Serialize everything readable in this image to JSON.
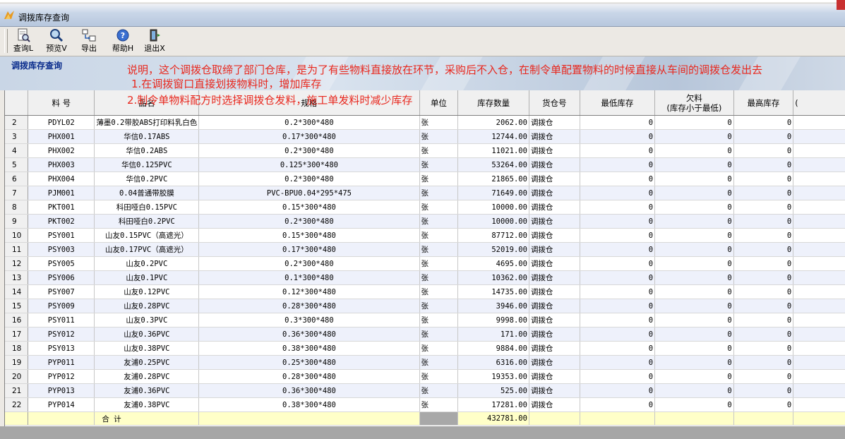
{
  "window": {
    "title": "调拨库存查询"
  },
  "toolbar": [
    {
      "name": "query-button",
      "icon": "document-search-icon",
      "label": "查询L"
    },
    {
      "name": "preview-button",
      "icon": "magnifier-icon",
      "label": "预览V"
    },
    {
      "name": "export-button",
      "icon": "export-icon",
      "label": "导出"
    },
    {
      "name": "help-button",
      "icon": "help-icon",
      "label": "帮助H"
    },
    {
      "name": "exit-button",
      "icon": "exit-door-icon",
      "label": "退出X"
    }
  ],
  "banner": {
    "title": "调拨库存查询",
    "note1": "说明，这个调拨仓取缔了部门仓库，是为了有些物料直接放在环节，采购后不入仓，在制令单配置物料的时候直接从车间的调拨仓发出去",
    "note2": "1.在调拨窗口直接划拨物料时，增加库存",
    "note3": "2.制令单物料配方时选择调拨仓发料，施工单发料时减少库存"
  },
  "columns": {
    "code": "料        号",
    "name": "品名",
    "spec": "规格",
    "unit": "单位",
    "qty": "库存数量",
    "warehouse": "货仓号",
    "min": "最低库存",
    "owe": "欠料",
    "owe_sub": "(库存小于最低)",
    "max": "最高库存",
    "extra": "("
  },
  "rows": [
    {
      "n": "2",
      "code": "PDYL02",
      "name": "薄墨0.2带胶ABS打印料乳白色",
      "spec": "0.2*300*480",
      "unit": "张",
      "qty": "2062.00",
      "wh": "调拨仓",
      "min": "0",
      "owe": "0",
      "max": "0"
    },
    {
      "n": "3",
      "code": "PHX001",
      "name": "华信0.17ABS",
      "spec": "0.17*300*480",
      "unit": "张",
      "qty": "12744.00",
      "wh": "调拨仓",
      "min": "0",
      "owe": "0",
      "max": "0"
    },
    {
      "n": "4",
      "code": "PHX002",
      "name": "华信0.2ABS",
      "spec": "0.2*300*480",
      "unit": "张",
      "qty": "11021.00",
      "wh": "调拨仓",
      "min": "0",
      "owe": "0",
      "max": "0"
    },
    {
      "n": "5",
      "code": "PHX003",
      "name": "华信0.125PVC",
      "spec": "0.125*300*480",
      "unit": "张",
      "qty": "53264.00",
      "wh": "调拨仓",
      "min": "0",
      "owe": "0",
      "max": "0"
    },
    {
      "n": "6",
      "code": "PHX004",
      "name": "华信0.2PVC",
      "spec": "0.2*300*480",
      "unit": "张",
      "qty": "21865.00",
      "wh": "调拨仓",
      "min": "0",
      "owe": "0",
      "max": "0"
    },
    {
      "n": "7",
      "code": "PJM001",
      "name": "0.04普通带胶膜",
      "spec": "PVC-BPU0.04*295*475",
      "unit": "张",
      "qty": "71649.00",
      "wh": "调拨仓",
      "min": "0",
      "owe": "0",
      "max": "0"
    },
    {
      "n": "8",
      "code": "PKT001",
      "name": "科田哑白0.15PVC",
      "spec": "0.15*300*480",
      "unit": "张",
      "qty": "10000.00",
      "wh": "调拨仓",
      "min": "0",
      "owe": "0",
      "max": "0"
    },
    {
      "n": "9",
      "code": "PKT002",
      "name": "科田哑白0.2PVC",
      "spec": "0.2*300*480",
      "unit": "张",
      "qty": "10000.00",
      "wh": "调拨仓",
      "min": "0",
      "owe": "0",
      "max": "0"
    },
    {
      "n": "10",
      "code": "PSY001",
      "name": "山友0.15PVC（高遮光）",
      "spec": "0.15*300*480",
      "unit": "张",
      "qty": "87712.00",
      "wh": "调拨仓",
      "min": "0",
      "owe": "0",
      "max": "0"
    },
    {
      "n": "11",
      "code": "PSY003",
      "name": "山友0.17PVC（高遮光）",
      "spec": "0.17*300*480",
      "unit": "张",
      "qty": "52019.00",
      "wh": "调拨仓",
      "min": "0",
      "owe": "0",
      "max": "0"
    },
    {
      "n": "12",
      "code": "PSY005",
      "name": "山友0.2PVC",
      "spec": "0.2*300*480",
      "unit": "张",
      "qty": "4695.00",
      "wh": "调拨仓",
      "min": "0",
      "owe": "0",
      "max": "0"
    },
    {
      "n": "13",
      "code": "PSY006",
      "name": "山友0.1PVC",
      "spec": "0.1*300*480",
      "unit": "张",
      "qty": "10362.00",
      "wh": "调拨仓",
      "min": "0",
      "owe": "0",
      "max": "0"
    },
    {
      "n": "14",
      "code": "PSY007",
      "name": "山友0.12PVC",
      "spec": "0.12*300*480",
      "unit": "张",
      "qty": "14735.00",
      "wh": "调拨仓",
      "min": "0",
      "owe": "0",
      "max": "0"
    },
    {
      "n": "15",
      "code": "PSY009",
      "name": "山友0.28PVC",
      "spec": "0.28*300*480",
      "unit": "张",
      "qty": "3946.00",
      "wh": "调拨仓",
      "min": "0",
      "owe": "0",
      "max": "0"
    },
    {
      "n": "16",
      "code": "PSY011",
      "name": "山友0.3PVC",
      "spec": "0.3*300*480",
      "unit": "张",
      "qty": "9998.00",
      "wh": "调拨仓",
      "min": "0",
      "owe": "0",
      "max": "0"
    },
    {
      "n": "17",
      "code": "PSY012",
      "name": "山友0.36PVC",
      "spec": "0.36*300*480",
      "unit": "张",
      "qty": "171.00",
      "wh": "调拨仓",
      "min": "0",
      "owe": "0",
      "max": "0"
    },
    {
      "n": "18",
      "code": "PSY013",
      "name": "山友0.38PVC",
      "spec": "0.38*300*480",
      "unit": "张",
      "qty": "9884.00",
      "wh": "调拨仓",
      "min": "0",
      "owe": "0",
      "max": "0"
    },
    {
      "n": "19",
      "code": "PYP011",
      "name": "友浦0.25PVC",
      "spec": "0.25*300*480",
      "unit": "张",
      "qty": "6316.00",
      "wh": "调拨仓",
      "min": "0",
      "owe": "0",
      "max": "0"
    },
    {
      "n": "20",
      "code": "PYP012",
      "name": "友浦0.28PVC",
      "spec": "0.28*300*480",
      "unit": "张",
      "qty": "19353.00",
      "wh": "调拨仓",
      "min": "0",
      "owe": "0",
      "max": "0"
    },
    {
      "n": "21",
      "code": "PYP013",
      "name": "友浦0.36PVC",
      "spec": "0.36*300*480",
      "unit": "张",
      "qty": "525.00",
      "wh": "调拨仓",
      "min": "0",
      "owe": "0",
      "max": "0"
    },
    {
      "n": "22",
      "code": "PYP014",
      "name": "友浦0.38PVC",
      "spec": "0.38*300*480",
      "unit": "张",
      "qty": "17281.00",
      "wh": "调拨仓",
      "min": "0",
      "owe": "0",
      "max": "0"
    }
  ],
  "total": {
    "label": "合        计",
    "qty": "432781.00"
  }
}
